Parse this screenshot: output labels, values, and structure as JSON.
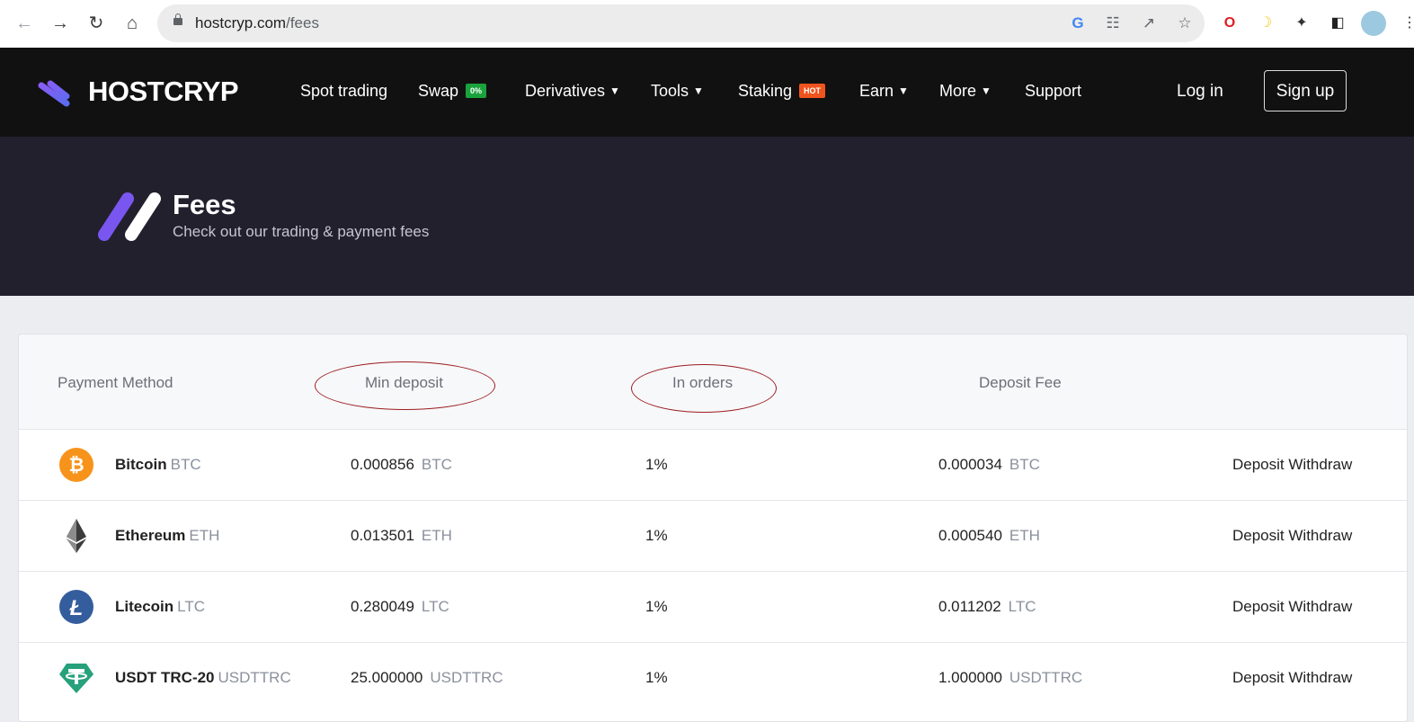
{
  "browser": {
    "url_domain": "hostcryp.com",
    "url_path": "/fees"
  },
  "header": {
    "brand": "HOSTCRYP",
    "nav": [
      {
        "label": "Spot trading"
      },
      {
        "label": "Swap",
        "badge": "0%",
        "badge_color": "#1aa33d"
      },
      {
        "label": "Derivatives",
        "dropdown": true
      },
      {
        "label": "Tools",
        "dropdown": true
      },
      {
        "label": "Staking",
        "badge": "HOT",
        "badge_color": "#f0541e"
      },
      {
        "label": "Earn",
        "dropdown": true
      },
      {
        "label": "More",
        "dropdown": true
      },
      {
        "label": "Support"
      }
    ],
    "login_label": "Log in",
    "signup_label": "Sign up"
  },
  "hero": {
    "title": "Fees",
    "subtitle": "Check out our trading & payment fees"
  },
  "table": {
    "columns": [
      "Payment Method",
      "Min deposit",
      "In orders",
      "Deposit Fee"
    ],
    "rows": [
      {
        "name": "Bitcoin",
        "symbol": "BTC",
        "icon": "bitcoin-icon",
        "min_deposit": "0.000856",
        "min_unit": "BTC",
        "in_orders": "1%",
        "fee": "0.000034",
        "fee_unit": "BTC"
      },
      {
        "name": "Ethereum",
        "symbol": "ETH",
        "icon": "ethereum-icon",
        "min_deposit": "0.013501",
        "min_unit": "ETH",
        "in_orders": "1%",
        "fee": "0.000540",
        "fee_unit": "ETH"
      },
      {
        "name": "Litecoin",
        "symbol": "LTC",
        "icon": "litecoin-icon",
        "min_deposit": "0.280049",
        "min_unit": "LTC",
        "in_orders": "1%",
        "fee": "0.011202",
        "fee_unit": "LTC"
      },
      {
        "name": "USDT TRC-20",
        "symbol": "USDTTRC",
        "icon": "tether-icon",
        "min_deposit": "25.000000",
        "min_unit": "USDTTRC",
        "in_orders": "1%",
        "fee": "1.000000",
        "fee_unit": "USDTTRC"
      }
    ],
    "deposit_label": "Deposit",
    "withdraw_label": "Withdraw"
  },
  "colors": {
    "accent_purple": "#7a56f0",
    "header_bg": "#111111",
    "hero_bg": "#23202e",
    "annotation_ellipse": "#9b1d20"
  }
}
